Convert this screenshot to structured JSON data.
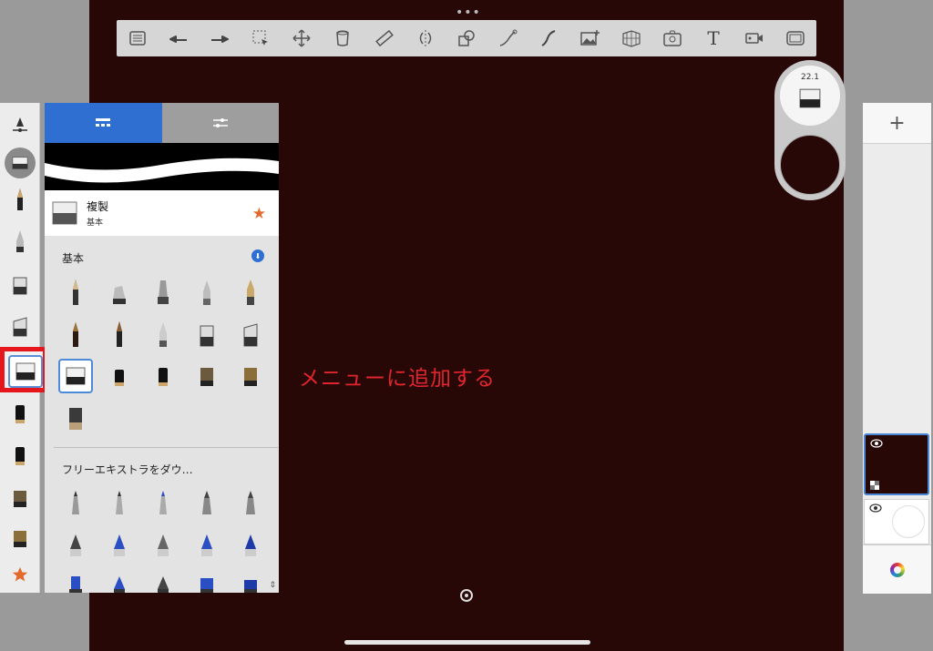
{
  "app": {
    "top_dots": "•••"
  },
  "toolbar": {
    "tools": [
      "lagoon-menu-icon",
      "undo-icon",
      "redo-icon",
      "selection-icon",
      "transform-icon",
      "fill-icon",
      "ruler-icon",
      "symmetry-icon",
      "shape-icon",
      "stroke-icon",
      "curve-icon",
      "image-icon",
      "perspective-icon",
      "timelapse-icon",
      "text-icon",
      "video-icon",
      "fullscreen-icon"
    ],
    "text_tool_label": "T"
  },
  "library": {
    "current_brush": {
      "name": "複製",
      "category": "基本"
    },
    "section_basic": "基本",
    "section_free": "フリーエキストラをダウ…",
    "pin_label": "📌"
  },
  "annotation": {
    "text": "メニューに追加する"
  },
  "puck": {
    "size_value": "22.1"
  },
  "layers": {
    "add_label": "+",
    "eye": "👁"
  },
  "colors": {
    "canvas": "#280707",
    "accent": "#2f6fd1",
    "highlight": "#e5161c",
    "star": "#e2692b"
  }
}
